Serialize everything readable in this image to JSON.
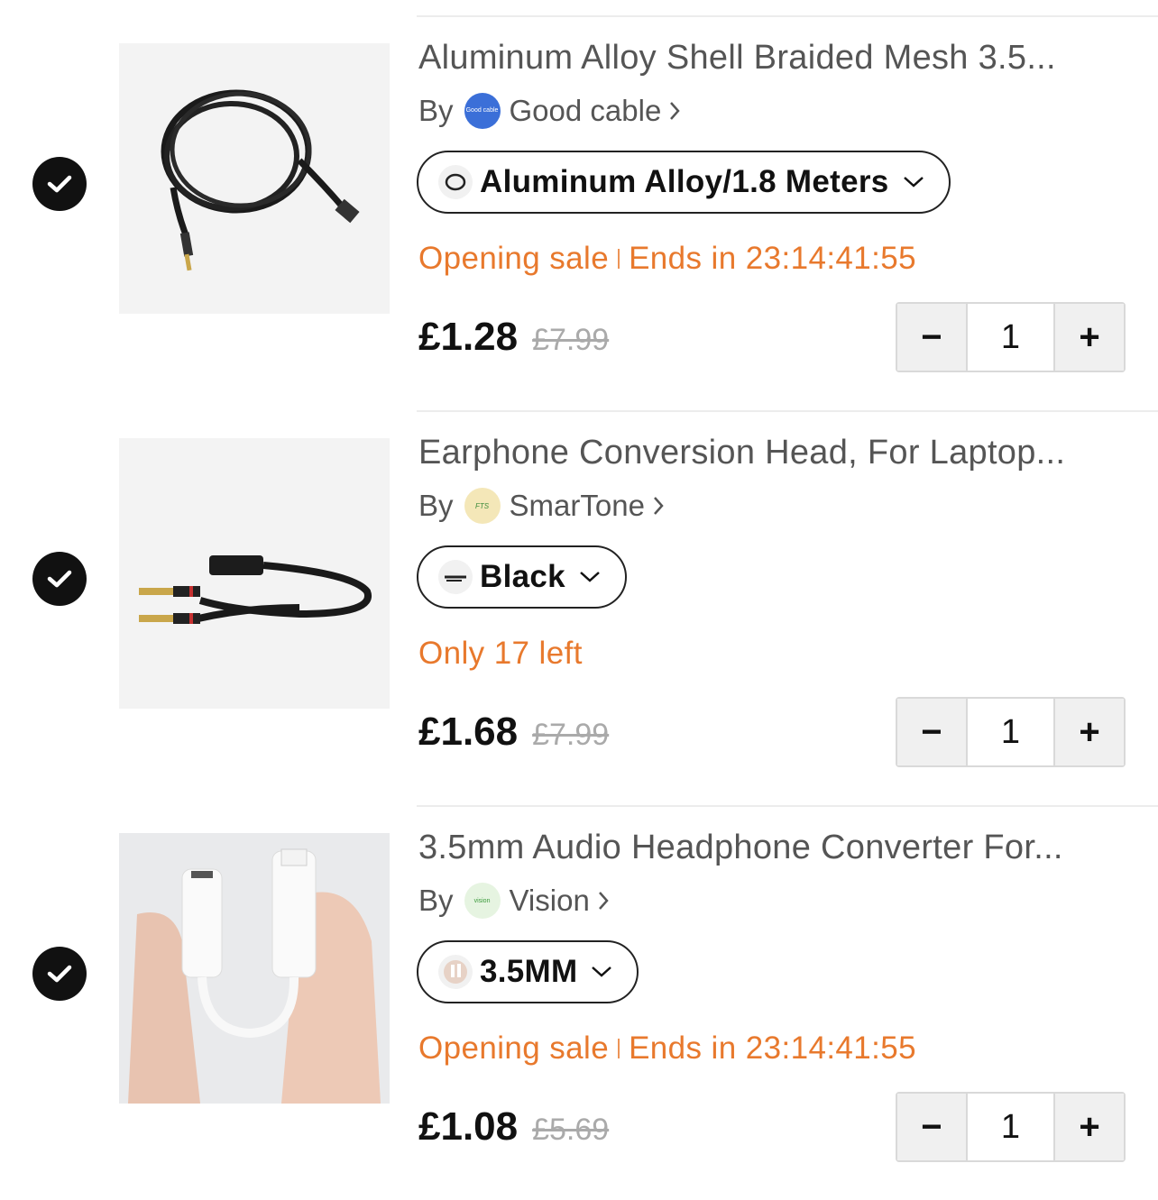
{
  "items": [
    {
      "title": "Aluminum Alloy Shell Braided Mesh 3.5...",
      "by_label": "By",
      "seller": "Good cable",
      "seller_logo_text": "Good cable",
      "variant": "Aluminum Alloy/1.8 Meters",
      "promo_label": "Opening sale",
      "promo_detail": "Ends in 23:14:41:55",
      "price": "£1.28",
      "original_price": "£7.99",
      "quantity": "1",
      "selected": true
    },
    {
      "title": "Earphone Conversion Head, For Laptop...",
      "by_label": "By",
      "seller": "SmarTone",
      "seller_logo_text": "FTS",
      "variant": "Black",
      "promo_label": "Only 17 left",
      "promo_detail": "",
      "price": "£1.68",
      "original_price": "£7.99",
      "quantity": "1",
      "selected": true
    },
    {
      "title": "3.5mm Audio Headphone Converter For...",
      "by_label": "By",
      "seller": "Vision",
      "seller_logo_text": "vision",
      "variant": "3.5MM",
      "promo_label": "Opening sale",
      "promo_detail": "Ends in 23:14:41:55",
      "price": "£1.08",
      "original_price": "£5.69",
      "quantity": "1",
      "selected": true
    }
  ],
  "stepper": {
    "minus": "−",
    "plus": "+"
  },
  "colors": {
    "promo": "#e8792d",
    "check": "#111111",
    "divider": "#ececec"
  },
  "icons": {
    "selected": "checkmark-icon",
    "seller_link": "chevron-right-icon",
    "variant_dropdown": "chevron-down-icon"
  }
}
